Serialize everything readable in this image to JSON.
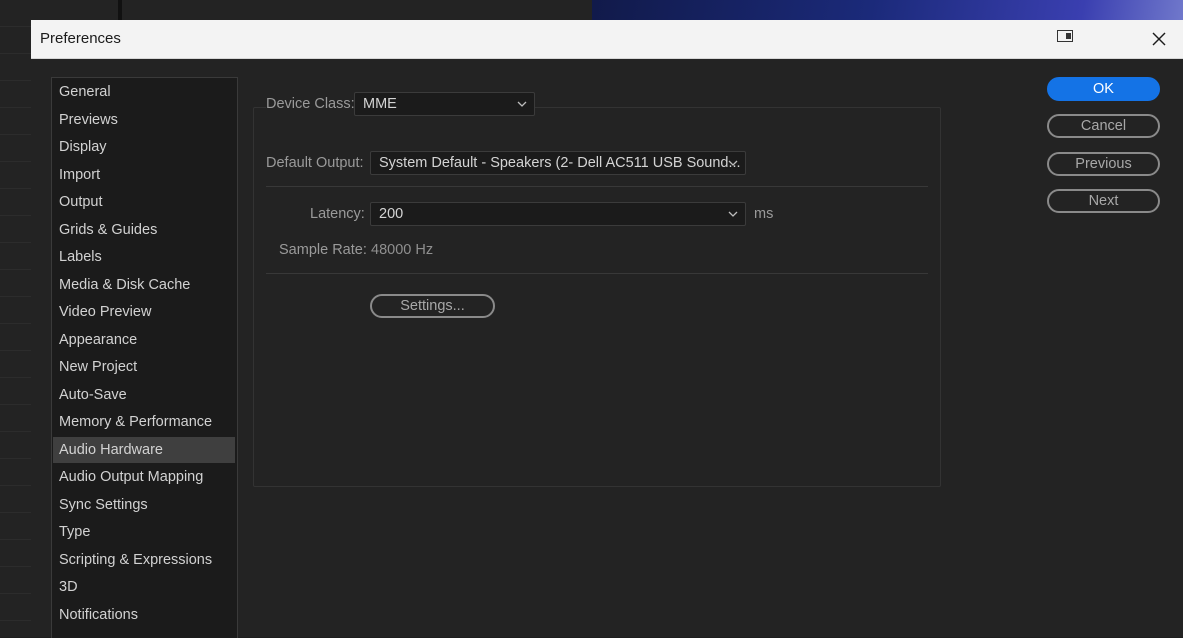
{
  "window": {
    "title": "Preferences",
    "snap_icon": "snap-layout-icon",
    "close_icon": "close-icon"
  },
  "sidebar": {
    "items": [
      {
        "label": "General"
      },
      {
        "label": "Previews"
      },
      {
        "label": "Display"
      },
      {
        "label": "Import"
      },
      {
        "label": "Output"
      },
      {
        "label": "Grids & Guides"
      },
      {
        "label": "Labels"
      },
      {
        "label": "Media & Disk Cache"
      },
      {
        "label": "Video Preview"
      },
      {
        "label": "Appearance"
      },
      {
        "label": "New Project"
      },
      {
        "label": "Auto-Save"
      },
      {
        "label": "Memory & Performance"
      },
      {
        "label": "Audio Hardware",
        "selected": true
      },
      {
        "label": "Audio Output Mapping"
      },
      {
        "label": "Sync Settings"
      },
      {
        "label": "Type"
      },
      {
        "label": "Scripting & Expressions"
      },
      {
        "label": "3D"
      },
      {
        "label": "Notifications"
      }
    ]
  },
  "audio_hardware": {
    "device_class_label": "Device Class:",
    "device_class_value": "MME",
    "default_output_label": "Default Output:",
    "default_output_value": "System Default - Speakers (2- Dell AC511 USB Sound...",
    "latency_label": "Latency:",
    "latency_value": "200",
    "latency_unit": "ms",
    "sample_rate_label": "Sample Rate:",
    "sample_rate_value": "48000 Hz",
    "settings_button": "Settings..."
  },
  "buttons": {
    "ok": "OK",
    "cancel": "Cancel",
    "previous": "Previous",
    "next": "Next"
  },
  "colors": {
    "accent": "#1473e6",
    "selected_item_bg": "#3f3f3f",
    "dialog_bg": "#232323"
  }
}
